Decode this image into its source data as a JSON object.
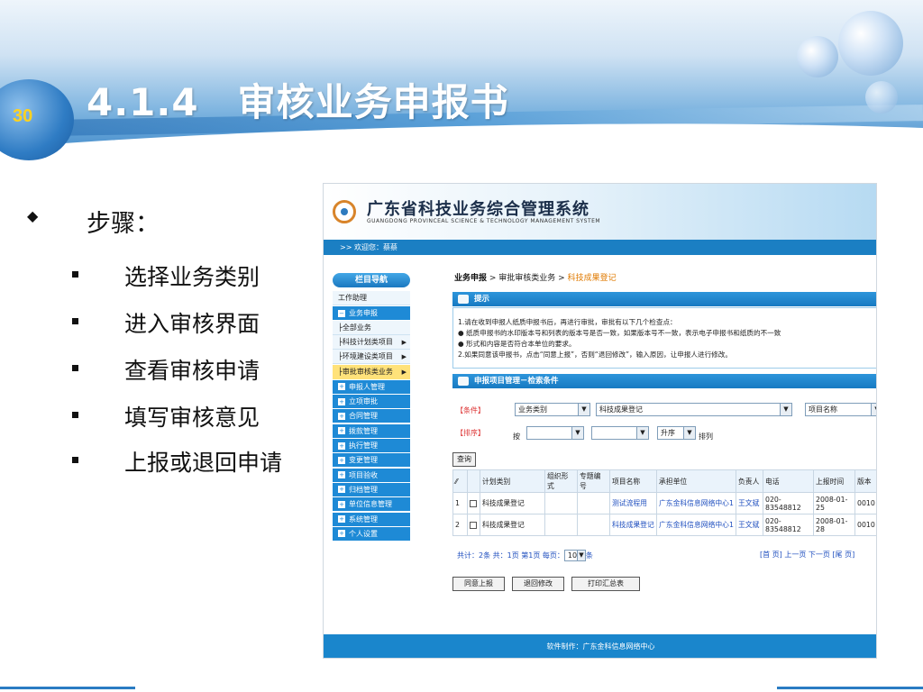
{
  "slide": {
    "number": "30",
    "title": "4.1.4　审核业务申报书"
  },
  "bullets": {
    "heading": "步骤：",
    "items": [
      "选择业务类别",
      "进入审核界面",
      "查看审核申请",
      "填写审核意见",
      "上报或退回申请"
    ]
  },
  "app": {
    "title": "广东省科技业务综合管理系统",
    "subtitle": "GUANGDONG PROVINCEAL SCIENCE & TECHNOLOGY MANAGEMENT SYSTEM",
    "welcome": ">> 欢迎您：蔡蔡",
    "sidebar": {
      "header": "栏目导航",
      "items": [
        {
          "label": "工作助理",
          "style": "light"
        },
        {
          "label": "业务申报",
          "style": "blue",
          "toggle": "−"
        },
        {
          "label": "├全部业务",
          "style": "light"
        },
        {
          "label": "├科技计划类项目",
          "style": "light",
          "arrow": "▶"
        },
        {
          "label": "├环境建设类项目",
          "style": "light",
          "arrow": "▶"
        },
        {
          "label": "├审批审核类业务",
          "style": "hi",
          "arrow": "▶"
        },
        {
          "label": "申报人管理",
          "style": "blue",
          "toggle": "+"
        },
        {
          "label": "立项审批",
          "style": "blue",
          "toggle": "+"
        },
        {
          "label": "合同管理",
          "style": "blue",
          "toggle": "+"
        },
        {
          "label": "拨款管理",
          "style": "blue",
          "toggle": "+"
        },
        {
          "label": "执行管理",
          "style": "blue",
          "toggle": "+"
        },
        {
          "label": "变更管理",
          "style": "blue",
          "toggle": "+"
        },
        {
          "label": "项目验收",
          "style": "blue",
          "toggle": "+"
        },
        {
          "label": "归档管理",
          "style": "blue",
          "toggle": "+"
        },
        {
          "label": "单位信息管理",
          "style": "blue",
          "toggle": "+"
        },
        {
          "label": "系统管理",
          "style": "blue",
          "toggle": "+"
        },
        {
          "label": "个人设置",
          "style": "blue",
          "toggle": "+"
        }
      ]
    },
    "breadcrumb": {
      "root": "业务申报",
      "sep1": " > ",
      "mid": "审批审核类业务",
      "sep2": " > ",
      "current": "科技成果登记"
    },
    "tip_bar": "提示",
    "tip_lines": [
      "1.请在收到申报人纸质申报书后，再进行审批，审批有以下几个检查点：",
      "●  纸质申报书的水印版本号和列表的版本号是否一致，如果版本号不一致，表示电子申报书和纸质的不一致",
      "●  形式和内容是否符合本单位的要求。",
      "2.如果同意该申报书，点击“同意上报”，否则“退回修改”，输入原因，让申报人进行修改。"
    ],
    "search_bar": "申报项目管理－检索条件",
    "conditions": {
      "cond_label": "【条件】",
      "sort_label": "【排序】",
      "field1": "业务类别",
      "field2": "科技成果登记",
      "field3": "项目名称",
      "sort_prefix": "按",
      "sort_order": "升序",
      "sort_suffix": "排列",
      "query_button": "查询"
    },
    "table": {
      "headers": [
        "",
        "",
        "计划类别",
        "组织形式",
        "专题编号",
        "项目名称",
        "承担单位",
        "负责人",
        "电话",
        "上报时间",
        "版本"
      ],
      "rows": [
        [
          "1",
          "",
          "科技成果登记",
          "",
          "",
          "测试流程用",
          "广东金科信息网络中心1",
          "王文斌",
          "020-83548812",
          "2008-01-25",
          "0010"
        ],
        [
          "2",
          "",
          "科技成果登记",
          "",
          "",
          "科技成果登记",
          "广东金科信息网络中心1",
          "王文斌",
          "020-83548812",
          "2008-01-28",
          "0010"
        ]
      ]
    },
    "pager": {
      "summary_pre": "共计：2条 共：1页 第1页 每页：",
      "per_page": "10",
      "summary_post": "条",
      "nav": "[首 页] 上一页 下一页 [尾 页]"
    },
    "actions": [
      "同意上报",
      "退回修改",
      "打印汇总表"
    ],
    "footer": "软件制作：广东金科信息网络中心"
  }
}
